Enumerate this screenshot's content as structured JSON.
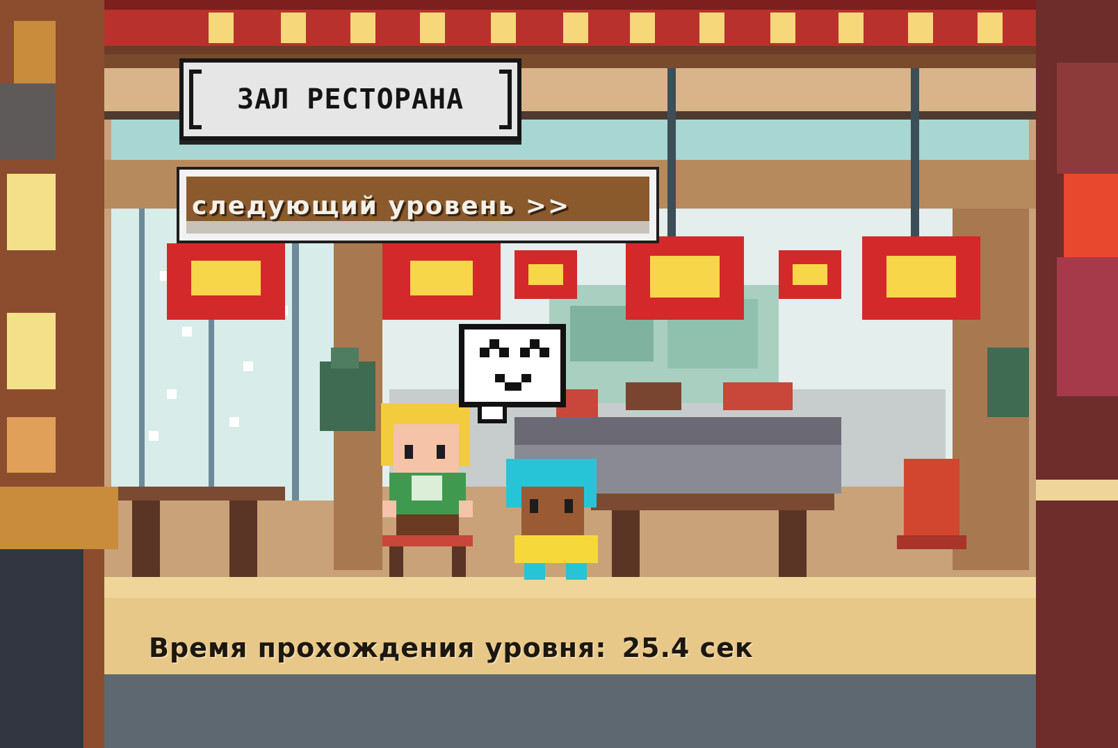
{
  "hud": {
    "level_title": "ЗАЛ РЕСТОРАНА",
    "next_level_label": "следующий уровень >>"
  },
  "level_result": {
    "time_label": "Время прохождения уровня:",
    "time_value": "25.4 сек"
  },
  "scene": {
    "location": "restaurant hall",
    "characters": [
      "blonde-girl-npc",
      "blue-haired-player"
    ],
    "speech_bubble_emote": "^_^",
    "colors": {
      "lantern_red": "#d4292b",
      "lantern_yellow": "#f7d64a",
      "floor_tan": "#e8c888",
      "wood_brown": "#9c6b3c",
      "window_glass": "#cfe7e5"
    }
  }
}
